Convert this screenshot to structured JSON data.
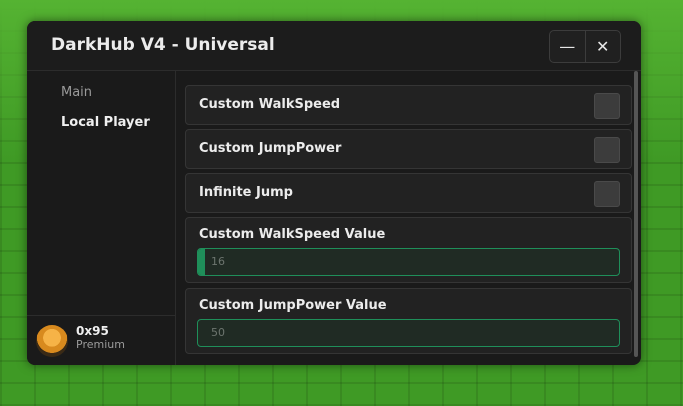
{
  "window": {
    "title": "DarkHub V4 - Universal",
    "minimize_icon": "minimize-icon",
    "close_icon": "close-icon"
  },
  "sidebar": {
    "items": [
      {
        "label": "Main",
        "active": false
      },
      {
        "label": "Local Player",
        "active": true
      }
    ],
    "profile": {
      "username": "0x95",
      "rank": "Premium"
    }
  },
  "main": {
    "toggles": [
      {
        "label": "Custom WalkSpeed",
        "checked": false
      },
      {
        "label": "Custom JumpPower",
        "checked": false
      },
      {
        "label": "Infinite Jump",
        "checked": false
      }
    ],
    "sliders": [
      {
        "label": "Custom WalkSpeed Value",
        "value": "16",
        "fill_fraction": 0.016
      },
      {
        "label": "Custom JumpPower Value",
        "value": "50",
        "fill_fraction": 0.0
      }
    ]
  },
  "colors": {
    "accent": "#1f8f5a",
    "background": "#1a1a1a",
    "grass": "#3f9a25"
  }
}
